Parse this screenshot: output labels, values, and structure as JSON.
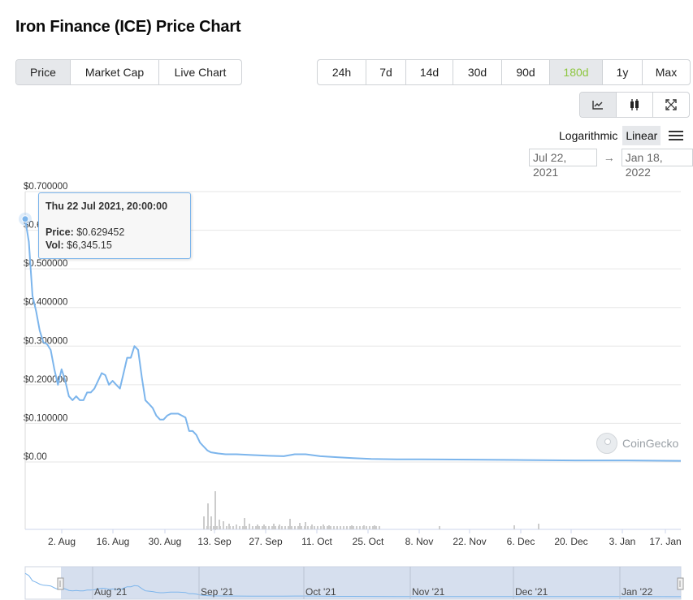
{
  "title": "Iron Finance (ICE) Price Chart",
  "tabs": [
    {
      "label": "Price",
      "active": true
    },
    {
      "label": "Market Cap",
      "active": false
    },
    {
      "label": "Live Chart",
      "active": false
    }
  ],
  "ranges": [
    {
      "label": "24h",
      "active": false
    },
    {
      "label": "7d",
      "active": false
    },
    {
      "label": "14d",
      "active": false
    },
    {
      "label": "30d",
      "active": false
    },
    {
      "label": "90d",
      "active": false
    },
    {
      "label": "180d",
      "active": true
    },
    {
      "label": "1y",
      "active": false
    },
    {
      "label": "Max",
      "active": false
    }
  ],
  "chart_tools": [
    {
      "icon": "line-chart-icon",
      "active": true
    },
    {
      "icon": "candlestick-icon",
      "active": false
    },
    {
      "icon": "expand-icon",
      "active": false
    }
  ],
  "scale": {
    "logarithmic": "Logarithmic",
    "linear": "Linear",
    "active": "Linear"
  },
  "date_range": {
    "from": "Jul 22, 2021",
    "to": "Jan 18, 2022",
    "arrow": "→"
  },
  "tooltip": {
    "date": "Thu 22 Jul 2021, 20:00:00",
    "price_label": "Price:",
    "price_value": "$0.629452",
    "vol_label": "Vol:",
    "vol_value": "$6,345.15"
  },
  "watermark": "CoinGecko",
  "colors": {
    "line": "#7cb5ec",
    "accent": "#8dc63f",
    "volume": "#cccccc"
  },
  "chart_data": {
    "type": "line",
    "title": "",
    "y_ticks": [
      "$0.700000",
      "$0.600000",
      "$0.500000",
      "$0.400000",
      "$0.300000",
      "$0.200000",
      "$0.100000",
      "$0.00"
    ],
    "ylim": [
      0,
      0.7
    ],
    "x_ticks": [
      "2. Aug",
      "16. Aug",
      "30. Aug",
      "13. Sep",
      "27. Sep",
      "11. Oct",
      "25. Oct",
      "8. Nov",
      "22. Nov",
      "6. Dec",
      "20. Dec",
      "3. Jan",
      "17. Jan"
    ],
    "navigator_ticks": [
      "Aug '21",
      "Sep '21",
      "Oct '21",
      "Nov '21",
      "Dec '21",
      "Jan '22"
    ],
    "x_range": [
      "2021-07-22",
      "2022-01-18"
    ],
    "series": [
      {
        "x": [
          "2021-07-22",
          "2021-07-23",
          "2021-07-24",
          "2021-07-25",
          "2021-07-26",
          "2021-07-27",
          "2021-07-28",
          "2021-07-29",
          "2021-07-30",
          "2021-07-31",
          "2021-08-01",
          "2021-08-02",
          "2021-08-03",
          "2021-08-04",
          "2021-08-05",
          "2021-08-06",
          "2021-08-07",
          "2021-08-08",
          "2021-08-09",
          "2021-08-10",
          "2021-08-11",
          "2021-08-12",
          "2021-08-13",
          "2021-08-14",
          "2021-08-15",
          "2021-08-16",
          "2021-08-17",
          "2021-08-18",
          "2021-08-19",
          "2021-08-20",
          "2021-08-21",
          "2021-08-22",
          "2021-08-23",
          "2021-08-24",
          "2021-08-25",
          "2021-08-26",
          "2021-08-27",
          "2021-08-28",
          "2021-08-29",
          "2021-08-30",
          "2021-08-31",
          "2021-09-01",
          "2021-09-02",
          "2021-09-03",
          "2021-09-04",
          "2021-09-05",
          "2021-09-06",
          "2021-09-07",
          "2021-09-08",
          "2021-09-09",
          "2021-09-10",
          "2021-09-11",
          "2021-09-13",
          "2021-09-15",
          "2021-09-18",
          "2021-09-22",
          "2021-09-27",
          "2021-10-01",
          "2021-10-04",
          "2021-10-07",
          "2021-10-11",
          "2021-10-16",
          "2021-10-20",
          "2021-10-25",
          "2021-11-01",
          "2021-11-08",
          "2021-11-22",
          "2021-12-06",
          "2021-12-20",
          "2022-01-03",
          "2022-01-18"
        ],
        "values": [
          0.629,
          0.57,
          0.43,
          0.39,
          0.34,
          0.31,
          0.305,
          0.29,
          0.24,
          0.2,
          0.24,
          0.21,
          0.17,
          0.16,
          0.17,
          0.16,
          0.16,
          0.18,
          0.18,
          0.19,
          0.21,
          0.23,
          0.225,
          0.2,
          0.21,
          0.2,
          0.19,
          0.23,
          0.27,
          0.27,
          0.3,
          0.29,
          0.22,
          0.16,
          0.15,
          0.14,
          0.12,
          0.11,
          0.11,
          0.12,
          0.125,
          0.125,
          0.125,
          0.12,
          0.115,
          0.08,
          0.08,
          0.07,
          0.05,
          0.04,
          0.03,
          0.025,
          0.022,
          0.02,
          0.02,
          0.018,
          0.016,
          0.015,
          0.02,
          0.02,
          0.015,
          0.012,
          0.01,
          0.008,
          0.007,
          0.007,
          0.006,
          0.005,
          0.004,
          0.004,
          0.003
        ]
      }
    ]
  }
}
